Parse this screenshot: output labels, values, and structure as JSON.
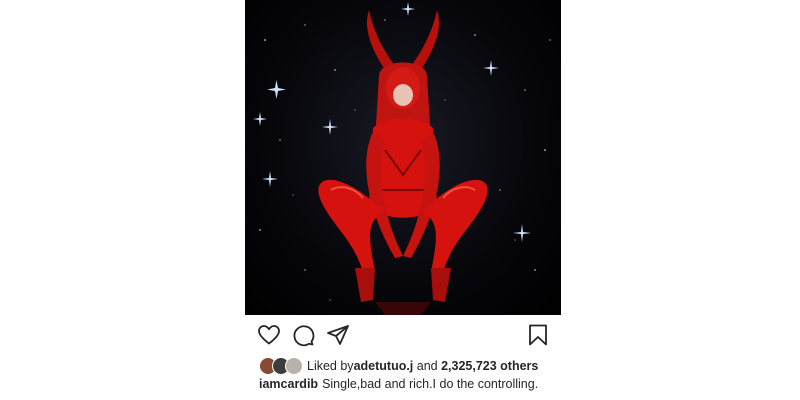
{
  "post": {
    "image_icon": "red-devil-costume-photo",
    "likes": {
      "prefix": "Liked by ",
      "user": "adetutuo.j",
      "middle": " and ",
      "count": "2,325,723 others"
    },
    "caption": {
      "username": "iamcardib",
      "text": "Single,bad and rich.I do the controlling."
    },
    "icons": [
      "heart-icon",
      "comment-icon",
      "share-icon",
      "bookmark-icon"
    ]
  },
  "colors": {
    "text": "#262626",
    "accent_red": "#d6120f",
    "background": "#000000"
  }
}
